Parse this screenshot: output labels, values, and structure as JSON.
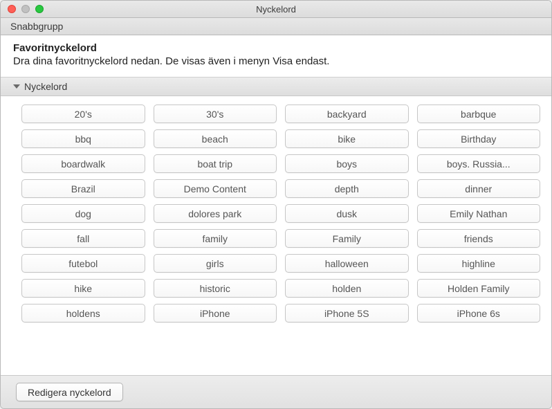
{
  "window": {
    "title": "Nyckelord"
  },
  "toolbar": {
    "quickgroup_label": "Snabbgrupp"
  },
  "favorites": {
    "title": "Favoritnyckelord",
    "description": "Dra dina favoritnyckelord nedan. De visas även i menyn Visa endast."
  },
  "keywords_section": {
    "header": "Nyckelord",
    "items": [
      "20's",
      "30's",
      "backyard",
      "barbque",
      "bbq",
      "beach",
      "bike",
      "Birthday",
      "boardwalk",
      "boat trip",
      "boys",
      "boys. Russia...",
      "Brazil",
      "Demo Content",
      "depth",
      "dinner",
      "dog",
      "dolores park",
      "dusk",
      "Emily Nathan",
      "fall",
      "family",
      "Family",
      "friends",
      "futebol",
      "girls",
      "halloween",
      "highline",
      "hike",
      "historic",
      "holden",
      "Holden Family",
      "holdens",
      "iPhone",
      "iPhone 5S",
      "iPhone 6s"
    ]
  },
  "bottom": {
    "edit_label": "Redigera nyckelord"
  }
}
